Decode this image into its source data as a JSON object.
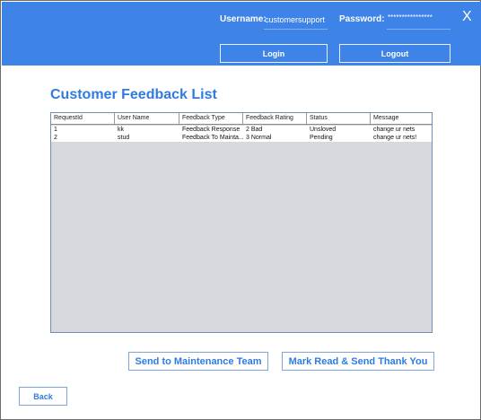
{
  "header": {
    "username_label": "Username:",
    "username_value": "customersupport",
    "password_label": "Password:",
    "password_value": "****************",
    "close_label": "X",
    "login_label": "Login",
    "logout_label": "Logout"
  },
  "main": {
    "title": "Customer Feedback List",
    "table": {
      "columns": [
        "RequestId",
        "User Name",
        "Feedback Type",
        "Feedback Rating",
        "Status",
        "Message"
      ],
      "rows": [
        [
          "1",
          "kk",
          "Feedback Response",
          "2 Bad",
          "Unsloved",
          "change ur nets"
        ],
        [
          "2",
          "stud",
          "Feedback To Mainta...",
          "3 Normal",
          "Pending",
          "change ur nets!"
        ]
      ]
    },
    "send_maintenance_label": "Send to Maintenance Team",
    "mark_read_label": "Mark Read & Send Thank You",
    "back_label": "Back"
  },
  "colors": {
    "header_blue": "#3e83e8",
    "title_blue": "#2f7be0",
    "table_bg": "#d7d9de"
  }
}
